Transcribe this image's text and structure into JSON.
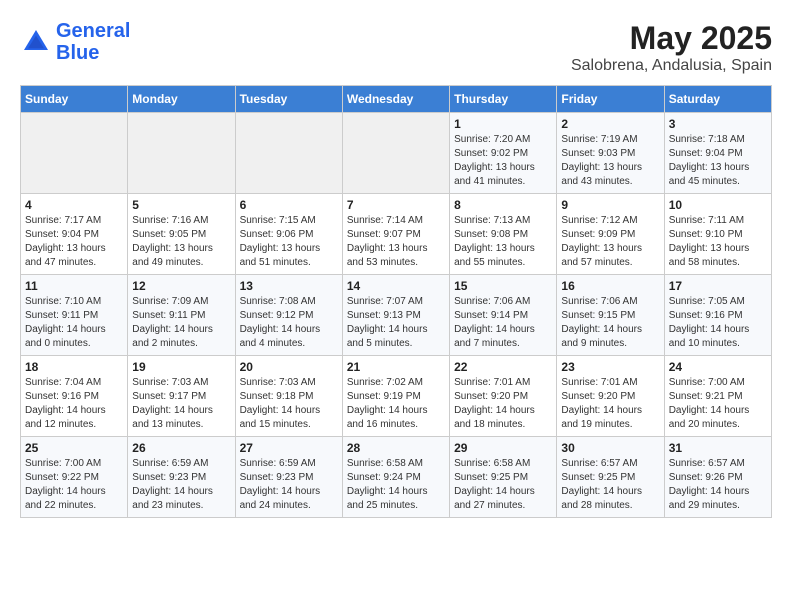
{
  "header": {
    "logo_line1": "General",
    "logo_line2": "Blue",
    "title": "May 2025",
    "subtitle": "Salobrena, Andalusia, Spain"
  },
  "days_of_week": [
    "Sunday",
    "Monday",
    "Tuesday",
    "Wednesday",
    "Thursday",
    "Friday",
    "Saturday"
  ],
  "weeks": [
    [
      {
        "day": "",
        "content": ""
      },
      {
        "day": "",
        "content": ""
      },
      {
        "day": "",
        "content": ""
      },
      {
        "day": "",
        "content": ""
      },
      {
        "day": "1",
        "content": "Sunrise: 7:20 AM\nSunset: 9:02 PM\nDaylight: 13 hours\nand 41 minutes."
      },
      {
        "day": "2",
        "content": "Sunrise: 7:19 AM\nSunset: 9:03 PM\nDaylight: 13 hours\nand 43 minutes."
      },
      {
        "day": "3",
        "content": "Sunrise: 7:18 AM\nSunset: 9:04 PM\nDaylight: 13 hours\nand 45 minutes."
      }
    ],
    [
      {
        "day": "4",
        "content": "Sunrise: 7:17 AM\nSunset: 9:04 PM\nDaylight: 13 hours\nand 47 minutes."
      },
      {
        "day": "5",
        "content": "Sunrise: 7:16 AM\nSunset: 9:05 PM\nDaylight: 13 hours\nand 49 minutes."
      },
      {
        "day": "6",
        "content": "Sunrise: 7:15 AM\nSunset: 9:06 PM\nDaylight: 13 hours\nand 51 minutes."
      },
      {
        "day": "7",
        "content": "Sunrise: 7:14 AM\nSunset: 9:07 PM\nDaylight: 13 hours\nand 53 minutes."
      },
      {
        "day": "8",
        "content": "Sunrise: 7:13 AM\nSunset: 9:08 PM\nDaylight: 13 hours\nand 55 minutes."
      },
      {
        "day": "9",
        "content": "Sunrise: 7:12 AM\nSunset: 9:09 PM\nDaylight: 13 hours\nand 57 minutes."
      },
      {
        "day": "10",
        "content": "Sunrise: 7:11 AM\nSunset: 9:10 PM\nDaylight: 13 hours\nand 58 minutes."
      }
    ],
    [
      {
        "day": "11",
        "content": "Sunrise: 7:10 AM\nSunset: 9:11 PM\nDaylight: 14 hours\nand 0 minutes."
      },
      {
        "day": "12",
        "content": "Sunrise: 7:09 AM\nSunset: 9:11 PM\nDaylight: 14 hours\nand 2 minutes."
      },
      {
        "day": "13",
        "content": "Sunrise: 7:08 AM\nSunset: 9:12 PM\nDaylight: 14 hours\nand 4 minutes."
      },
      {
        "day": "14",
        "content": "Sunrise: 7:07 AM\nSunset: 9:13 PM\nDaylight: 14 hours\nand 5 minutes."
      },
      {
        "day": "15",
        "content": "Sunrise: 7:06 AM\nSunset: 9:14 PM\nDaylight: 14 hours\nand 7 minutes."
      },
      {
        "day": "16",
        "content": "Sunrise: 7:06 AM\nSunset: 9:15 PM\nDaylight: 14 hours\nand 9 minutes."
      },
      {
        "day": "17",
        "content": "Sunrise: 7:05 AM\nSunset: 9:16 PM\nDaylight: 14 hours\nand 10 minutes."
      }
    ],
    [
      {
        "day": "18",
        "content": "Sunrise: 7:04 AM\nSunset: 9:16 PM\nDaylight: 14 hours\nand 12 minutes."
      },
      {
        "day": "19",
        "content": "Sunrise: 7:03 AM\nSunset: 9:17 PM\nDaylight: 14 hours\nand 13 minutes."
      },
      {
        "day": "20",
        "content": "Sunrise: 7:03 AM\nSunset: 9:18 PM\nDaylight: 14 hours\nand 15 minutes."
      },
      {
        "day": "21",
        "content": "Sunrise: 7:02 AM\nSunset: 9:19 PM\nDaylight: 14 hours\nand 16 minutes."
      },
      {
        "day": "22",
        "content": "Sunrise: 7:01 AM\nSunset: 9:20 PM\nDaylight: 14 hours\nand 18 minutes."
      },
      {
        "day": "23",
        "content": "Sunrise: 7:01 AM\nSunset: 9:20 PM\nDaylight: 14 hours\nand 19 minutes."
      },
      {
        "day": "24",
        "content": "Sunrise: 7:00 AM\nSunset: 9:21 PM\nDaylight: 14 hours\nand 20 minutes."
      }
    ],
    [
      {
        "day": "25",
        "content": "Sunrise: 7:00 AM\nSunset: 9:22 PM\nDaylight: 14 hours\nand 22 minutes."
      },
      {
        "day": "26",
        "content": "Sunrise: 6:59 AM\nSunset: 9:23 PM\nDaylight: 14 hours\nand 23 minutes."
      },
      {
        "day": "27",
        "content": "Sunrise: 6:59 AM\nSunset: 9:23 PM\nDaylight: 14 hours\nand 24 minutes."
      },
      {
        "day": "28",
        "content": "Sunrise: 6:58 AM\nSunset: 9:24 PM\nDaylight: 14 hours\nand 25 minutes."
      },
      {
        "day": "29",
        "content": "Sunrise: 6:58 AM\nSunset: 9:25 PM\nDaylight: 14 hours\nand 27 minutes."
      },
      {
        "day": "30",
        "content": "Sunrise: 6:57 AM\nSunset: 9:25 PM\nDaylight: 14 hours\nand 28 minutes."
      },
      {
        "day": "31",
        "content": "Sunrise: 6:57 AM\nSunset: 9:26 PM\nDaylight: 14 hours\nand 29 minutes."
      }
    ]
  ]
}
